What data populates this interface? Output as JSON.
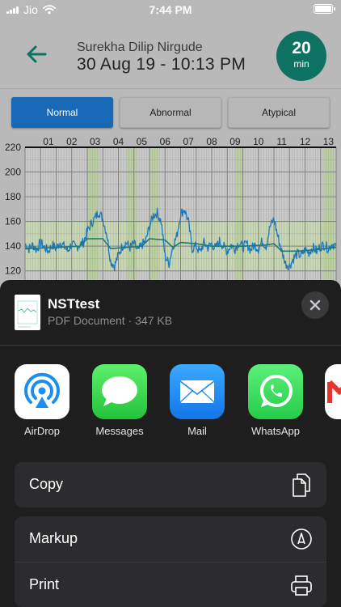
{
  "status_bar": {
    "carrier": "Jio",
    "time": "7:44 PM"
  },
  "header": {
    "patient_name": "Surekha Dilip Nirgude",
    "datetime": "30 Aug 19 - 10:13 PM",
    "duration_value": "20",
    "duration_unit": "min"
  },
  "classification_tabs": [
    {
      "label": "Normal",
      "selected": true
    },
    {
      "label": "Abnormal",
      "selected": false
    },
    {
      "label": "Atypical",
      "selected": false
    }
  ],
  "chart_data": {
    "type": "line",
    "x_ticks": [
      "01",
      "02",
      "03",
      "04",
      "05",
      "06",
      "07",
      "08",
      "09",
      "10",
      "11",
      "12",
      "13"
    ],
    "y_ticks": [
      120,
      140,
      160,
      180,
      200,
      220
    ],
    "ylim": [
      110,
      220
    ],
    "normal_band": [
      120,
      160
    ],
    "series": [
      {
        "values": [
          [
            0.0,
            142
          ],
          [
            0.25,
            138
          ],
          [
            0.5,
            141
          ],
          [
            0.75,
            137
          ],
          [
            1.0,
            143
          ],
          [
            1.25,
            139
          ],
          [
            1.5,
            136
          ],
          [
            1.75,
            141
          ],
          [
            2.0,
            138
          ],
          [
            2.25,
            143
          ],
          [
            2.5,
            140
          ],
          [
            2.75,
            136
          ],
          [
            3.0,
            142
          ],
          [
            3.25,
            139
          ],
          [
            3.5,
            141
          ],
          [
            3.75,
            143
          ],
          [
            4.0,
            152
          ],
          [
            4.25,
            158
          ],
          [
            4.5,
            163
          ],
          [
            4.75,
            168
          ],
          [
            5.0,
            162
          ],
          [
            5.25,
            150
          ],
          [
            5.5,
            128
          ],
          [
            5.75,
            124
          ],
          [
            6.0,
            133
          ],
          [
            6.25,
            140
          ],
          [
            6.5,
            143
          ],
          [
            6.75,
            139
          ],
          [
            7.0,
            142
          ],
          [
            7.25,
            136
          ],
          [
            7.5,
            141
          ],
          [
            7.75,
            144
          ],
          [
            8.0,
            156
          ],
          [
            8.25,
            165
          ],
          [
            8.5,
            167
          ],
          [
            8.75,
            160
          ],
          [
            9.0,
            132
          ],
          [
            9.25,
            126
          ],
          [
            9.5,
            140
          ],
          [
            9.75,
            148
          ],
          [
            10.0,
            166
          ],
          [
            10.25,
            170
          ],
          [
            10.5,
            160
          ],
          [
            10.75,
            138
          ],
          [
            11.0,
            140
          ],
          [
            11.25,
            135
          ],
          [
            11.5,
            143
          ],
          [
            11.75,
            139
          ],
          [
            12.0,
            142
          ],
          [
            12.25,
            138
          ],
          [
            12.5,
            144
          ],
          [
            12.75,
            140
          ],
          [
            13.0,
            136
          ],
          [
            13.25,
            141
          ],
          [
            13.5,
            138
          ],
          [
            13.75,
            143
          ],
          [
            14.0,
            139
          ],
          [
            14.25,
            142
          ],
          [
            14.5,
            137
          ],
          [
            14.75,
            141
          ],
          [
            15.0,
            138
          ],
          [
            15.25,
            144
          ],
          [
            15.5,
            140
          ],
          [
            15.75,
            156
          ],
          [
            16.0,
            162
          ],
          [
            16.25,
            148
          ],
          [
            16.5,
            136
          ],
          [
            16.75,
            126
          ],
          [
            17.0,
            124
          ],
          [
            17.25,
            130
          ],
          [
            17.5,
            134
          ],
          [
            17.75,
            132
          ],
          [
            18.0,
            137
          ],
          [
            18.25,
            135
          ],
          [
            18.5,
            139
          ],
          [
            18.75,
            136
          ],
          [
            19.0,
            140
          ],
          [
            19.25,
            141
          ],
          [
            19.5,
            138
          ],
          [
            19.75,
            142
          ],
          [
            20.0,
            140
          ]
        ]
      },
      {
        "values": [
          [
            0.0,
            138
          ],
          [
            2.0,
            139
          ],
          [
            3.5,
            140
          ],
          [
            4.0,
            146
          ],
          [
            5.0,
            146
          ],
          [
            5.5,
            138
          ],
          [
            6.5,
            139
          ],
          [
            7.5,
            140
          ],
          [
            8.0,
            146
          ],
          [
            9.0,
            145
          ],
          [
            9.5,
            139
          ],
          [
            10.0,
            143
          ],
          [
            11.0,
            142
          ],
          [
            12.0,
            140
          ],
          [
            14.0,
            140
          ],
          [
            15.5,
            141
          ],
          [
            16.0,
            142
          ],
          [
            16.5,
            136
          ],
          [
            17.5,
            136
          ],
          [
            18.5,
            137
          ],
          [
            20.0,
            139
          ]
        ]
      }
    ],
    "accel_bands": [
      [
        3.95,
        4.75
      ],
      [
        6.55,
        7.2
      ],
      [
        8.0,
        8.6
      ],
      [
        13.5,
        14.1
      ],
      [
        19.2,
        19.9
      ]
    ],
    "colors": {
      "fhr": "#1a78c2",
      "baseline": "#1e7a72",
      "band": "#c8dcae",
      "accel": "#b4cf90"
    }
  },
  "share_sheet": {
    "file_name": "NSTtest",
    "file_meta": "PDF Document · 347 KB",
    "apps": [
      {
        "label": "AirDrop",
        "icon": "airdrop-icon"
      },
      {
        "label": "Messages",
        "icon": "messages-icon"
      },
      {
        "label": "Mail",
        "icon": "mail-icon"
      },
      {
        "label": "WhatsApp",
        "icon": "whatsapp-icon"
      },
      {
        "label": "",
        "icon": "gmail-icon"
      }
    ],
    "actions_group1": [
      {
        "label": "Copy",
        "icon": "copy-icon"
      }
    ],
    "actions_group2": [
      {
        "label": "Markup",
        "icon": "markup-icon"
      },
      {
        "label": "Print",
        "icon": "print-icon"
      }
    ]
  }
}
